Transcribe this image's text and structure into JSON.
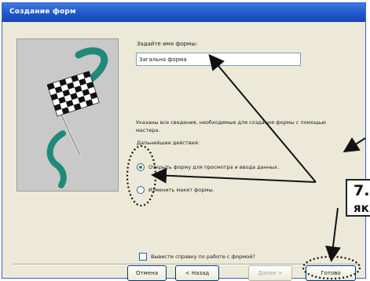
{
  "window": {
    "title": "Создание форм"
  },
  "form_name": {
    "label": "Задайте имя формы:",
    "value": "Загальна форма"
  },
  "info": {
    "text": "Указаны все сведения, необходимые для создания формы с помощью мастера.",
    "next_label": "Дальнейшие действия:"
  },
  "options": [
    {
      "label": "Открыть форму для просмотра и ввода данных.",
      "checked": true
    },
    {
      "label": "Изменить макет формы.",
      "checked": false
    }
  ],
  "help_checkbox": {
    "label": "Вывести справку по работе с формой?",
    "checked": false
  },
  "buttons": {
    "cancel": "Отмена",
    "back": "< Назад",
    "next": "Далее >",
    "finish": "Готово"
  },
  "callout": {
    "line1": "7.",
    "line2": "як"
  },
  "colors": {
    "titlebar": "#1f55c8",
    "dialog_bg": "#ece9d8",
    "image_bg": "#c9c9c9",
    "flag_accent": "#1f8a7a"
  },
  "icons": {
    "wizard_image": "checkered-flag-icon"
  }
}
